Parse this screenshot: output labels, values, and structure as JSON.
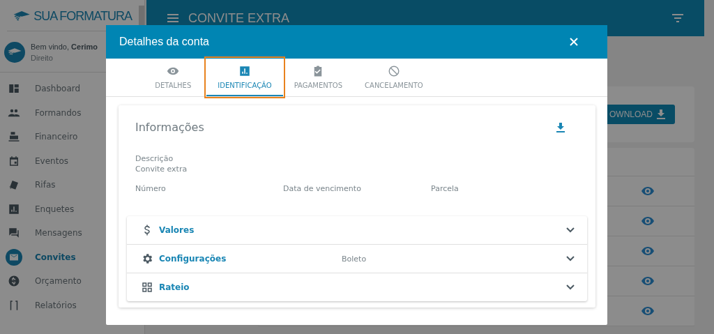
{
  "sidebar": {
    "logo": "SUA FORMATURA",
    "user": {
      "greeting": "Bem vindo, **Cerimo**",
      "course": "Direito"
    },
    "items": [
      {
        "label": "Dashboard",
        "selected": false
      },
      {
        "label": "Formandos",
        "selected": false
      },
      {
        "label": "Financeiro",
        "selected": false
      },
      {
        "label": "Eventos",
        "selected": false
      },
      {
        "label": "Rifas",
        "selected": false
      },
      {
        "label": "Enquetes",
        "selected": false
      },
      {
        "label": "Mensagens",
        "selected": false
      },
      {
        "label": "Convites",
        "selected": true
      },
      {
        "label": "Orçamento",
        "selected": false
      },
      {
        "label": "Relatórios",
        "selected": false
      }
    ]
  },
  "header": {
    "title": "CONVITE EXTRA"
  },
  "toolbar": {
    "button": "OWNLOAD"
  },
  "modal": {
    "title": "Detalhes da conta",
    "tabs": [
      {
        "label": "DETALHES",
        "selected": false,
        "highlighted": false
      },
      {
        "label": "IDENTIFICAÇÃO",
        "selected": true,
        "highlighted": true
      },
      {
        "label": "PAGAMENTOS",
        "selected": false,
        "highlighted": false
      },
      {
        "label": "CANCELAMENTO",
        "selected": false,
        "highlighted": false
      }
    ],
    "section": {
      "title": "Informações",
      "fields": [
        {
          "label": "Descrição",
          "value": "Convite extra"
        }
      ],
      "columns": [
        "Número",
        "Data de vencimento",
        "Parcela"
      ]
    },
    "panels": [
      {
        "title": "Valores"
      },
      {
        "title": "Configurações",
        "value": "Boleto"
      },
      {
        "title": "Rateio"
      }
    ]
  }
}
